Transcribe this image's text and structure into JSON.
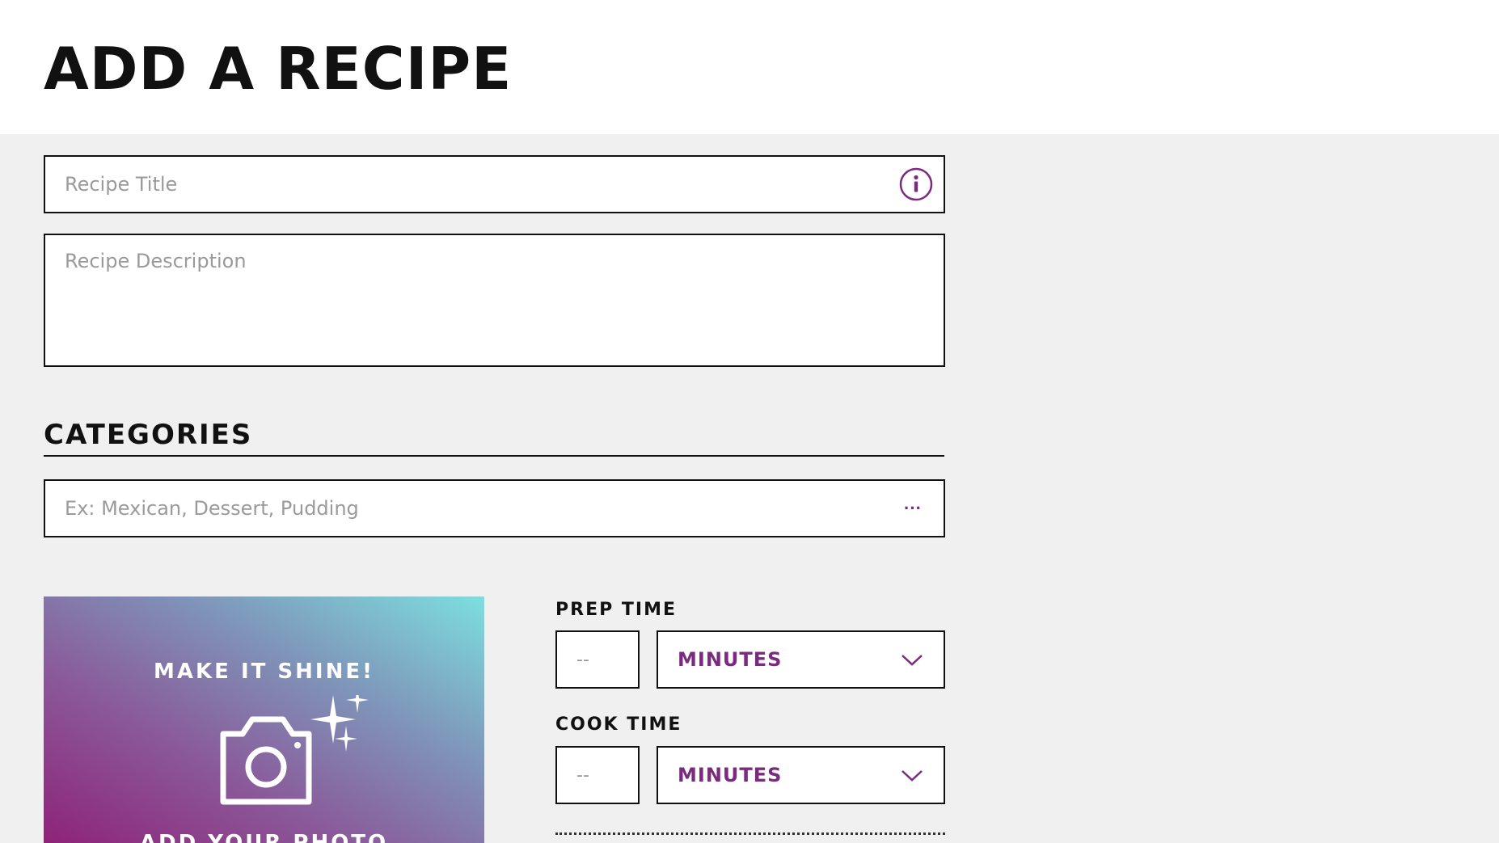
{
  "page": {
    "title": "ADD A RECIPE"
  },
  "form": {
    "title_placeholder": "Recipe Title",
    "title_value": "",
    "description_placeholder": "Recipe Description",
    "description_value": "",
    "categories_heading": "CATEGORIES",
    "categories_placeholder": "Ex: Mexican, Dessert, Pudding",
    "categories_value": "",
    "more_glyph": "···"
  },
  "photo": {
    "heading": "MAKE IT SHINE!",
    "cta": "ADD YOUR PHOTO"
  },
  "times": {
    "prep": {
      "label": "PREP TIME",
      "placeholder": "--",
      "value": "",
      "unit": "MINUTES"
    },
    "cook": {
      "label": "COOK TIME",
      "placeholder": "--",
      "value": "",
      "unit": "MINUTES"
    }
  },
  "icons": {
    "title_info": "info-icon",
    "categories_more": "more-icon",
    "photo": "camera-icon",
    "sparkle": "sparkle-icon",
    "select": "chevron-down-icon"
  },
  "colors": {
    "accent": "#7b2b7f",
    "background": "#f0f0f0",
    "header": "#ffffff",
    "border": "#111111",
    "placeholder": "#9a9a9a",
    "gradient_start": "#8e2379",
    "gradient_end": "#7cdfdf"
  }
}
